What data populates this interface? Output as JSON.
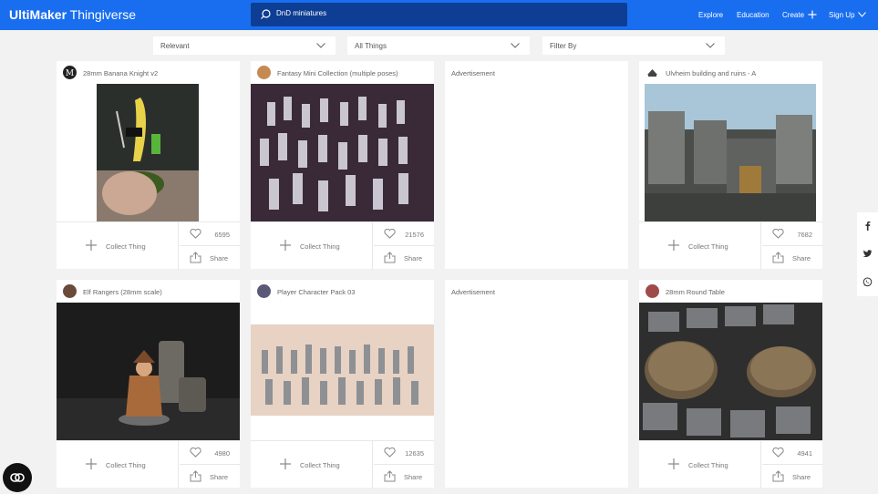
{
  "header": {
    "logo_brand": "UltiMaker",
    "logo_product": "Thingiverse",
    "search_value": "DnD miniatures",
    "nav": {
      "explore": "Explore",
      "education": "Education",
      "create": "Create",
      "signup": "Sign Up"
    }
  },
  "filters": {
    "sort": "Relevant",
    "category": "All Things",
    "filter_by": "Filter By"
  },
  "cards": [
    {
      "title": "28mm Banana Knight v2",
      "likes": "6595",
      "collect": "Collect Thing",
      "share": "Share"
    },
    {
      "title": "Fantasy Mini Collection (multiple poses)",
      "likes": "21576",
      "collect": "Collect Thing",
      "share": "Share"
    },
    {
      "title": "Ulvheim building and ruins - A",
      "likes": "7682",
      "collect": "Collect Thing",
      "share": "Share"
    },
    {
      "title": "Elf Rangers (28mm scale)",
      "likes": "4980",
      "collect": "Collect Thing",
      "share": "Share"
    },
    {
      "title": "Player Character Pack 03",
      "likes": "12635",
      "collect": "Collect Thing",
      "share": "Share"
    },
    {
      "title": "28mm Round Table",
      "likes": "4941",
      "collect": "Collect Thing",
      "share": "Share"
    }
  ],
  "ads": [
    "Advertisement",
    "Advertisement"
  ],
  "colors": {
    "brand_blue": "#196ef0",
    "search_bg": "#0d3e94",
    "page_bg": "#f2f2f2"
  },
  "icons": [
    "search-icon",
    "plus-icon",
    "chevron-down-icon",
    "heart-icon",
    "share-icon",
    "facebook-icon",
    "twitter-icon",
    "whatsapp-icon",
    "cookie-settings-icon"
  ]
}
